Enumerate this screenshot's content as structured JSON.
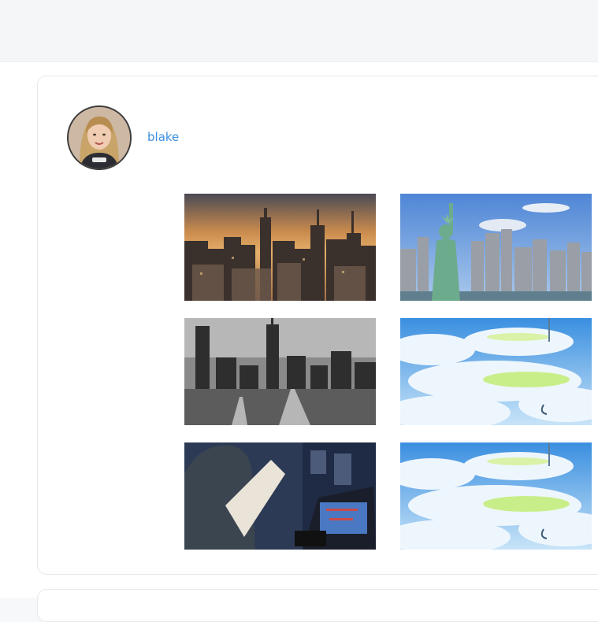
{
  "post": {
    "author": "blake",
    "photos": [
      {
        "name": "nyc-sunset-skyline-photo"
      },
      {
        "name": "statue-of-liberty-photo"
      },
      {
        "name": "bw-vintage-skyline-photo"
      },
      {
        "name": "anime-sky-clouds-photo"
      },
      {
        "name": "hooded-person-laptop-photo"
      },
      {
        "name": "anime-sky-clouds-photo-2"
      }
    ]
  },
  "colors": {
    "link": "#3d8fe0",
    "card_border": "#e6e8eb",
    "topbar": "#f5f6f8"
  }
}
